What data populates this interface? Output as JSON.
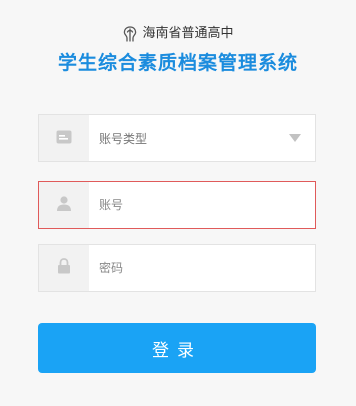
{
  "header": {
    "school_name": "海南省普通高中",
    "system_title": "学生综合素质档案管理系统"
  },
  "form": {
    "account_type": {
      "selected": "账号类型",
      "icon": "card-icon"
    },
    "account": {
      "placeholder": "账号",
      "value": "",
      "icon": "user-icon"
    },
    "password": {
      "placeholder": "密码",
      "value": "",
      "icon": "lock-icon"
    },
    "login_label": "登录"
  },
  "colors": {
    "title": "#1b8cde",
    "button": "#1aa3f5",
    "error_border": "#e05a5a",
    "background": "#f7f7f7"
  }
}
